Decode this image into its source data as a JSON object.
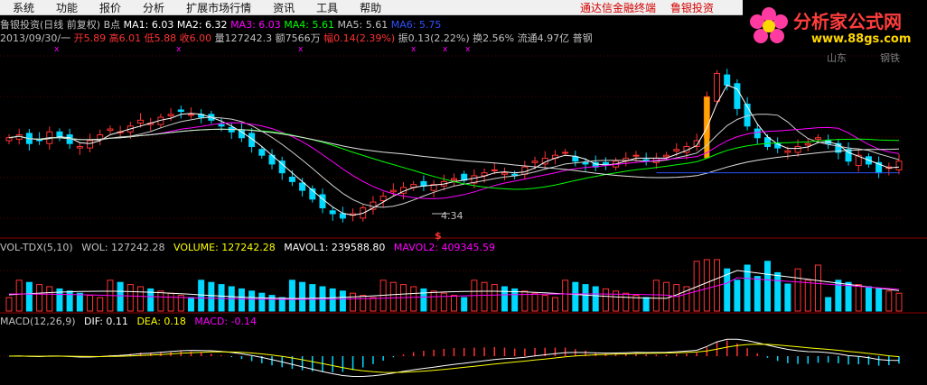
{
  "menu": [
    "系统",
    "功能",
    "报价",
    "分析",
    "扩展市场行情",
    "资讯",
    "工具",
    "帮助"
  ],
  "menu_right": [
    "通达信金融终端",
    "鲁银投资"
  ],
  "brand": {
    "name": "分析家公式网",
    "url": "www.88gs.com"
  },
  "chart_header": {
    "title": "鲁银投资(日线 前复权) B点",
    "ma1": "MA1: 6.03",
    "ma2": "MA2: 6.32",
    "ma3": "MA3: 6.03",
    "ma4": "MA4: 5.61",
    "ma5": "MA5: 5.61",
    "ma6": "MA6: 5.75"
  },
  "quote_line": {
    "date": "2013/09/30/一",
    "open": "开5.89",
    "high": "高6.01",
    "low": "低5.88",
    "close": "收6.00",
    "volume": "量127242.3",
    "amount": "额7566万",
    "change": "幅0.14(2.39%)",
    "amplitude": "振0.13(2.22%)",
    "turnover": "换2.56%",
    "float": "流通4.97亿",
    "sector": "普钢"
  },
  "price_annotations": {
    "low_label": "4.34",
    "signal_mark": "$",
    "tags": [
      "山东",
      "钢铁"
    ]
  },
  "volume_panel": {
    "name": "VOL-TDX(5,10)",
    "wol": "WOL: 127242.28",
    "volume": "VOLUME: 127242.28",
    "mavol1": "MAVOL1: 239588.80",
    "mavol2": "MAVOL2: 409345.59"
  },
  "macd_panel": {
    "name": "MACD(12,26,9)",
    "dif": "DIF: 0.11",
    "dea": "DEA: 0.18",
    "macd": "MACD: -0.14"
  },
  "colors": {
    "up": "#ff3232",
    "down": "#00d8ff",
    "ma_white": "#ffffff",
    "ma_yellow": "#ffff00",
    "ma_magenta": "#ff00ff",
    "ma_green": "#00ff00",
    "text_muted": "#c0c0c0"
  },
  "chart_data": {
    "type": "candlestick",
    "close_series": [
      7.2,
      7.3,
      7.0,
      7.1,
      7.4,
      7.2,
      7.0,
      6.9,
      7.1,
      7.3,
      7.5,
      7.4,
      7.6,
      7.8,
      7.7,
      7.9,
      8.0,
      8.1,
      8.0,
      7.9,
      7.8,
      7.6,
      7.4,
      7.2,
      6.9,
      6.6,
      6.3,
      6.0,
      5.7,
      5.4,
      5.1,
      4.8,
      4.6,
      4.45,
      4.6,
      4.8,
      5.0,
      5.2,
      5.4,
      5.5,
      5.6,
      5.55,
      5.6,
      5.7,
      5.8,
      5.75,
      5.9,
      6.0,
      6.1,
      6.0,
      5.9,
      6.2,
      6.4,
      6.5,
      6.6,
      6.7,
      6.4,
      6.3,
      6.2,
      6.3,
      6.4,
      6.5,
      6.6,
      6.4,
      6.5,
      6.6,
      6.8,
      6.9,
      7.1,
      8.6,
      9.4,
      9.0,
      8.2,
      7.6,
      7.2,
      6.9,
      6.85,
      6.75,
      6.9,
      7.0,
      7.2,
      7.0,
      6.7,
      6.4,
      6.6,
      6.3,
      6.0,
      6.2,
      6.4
    ],
    "ylim": [
      4.2,
      10.0
    ]
  }
}
